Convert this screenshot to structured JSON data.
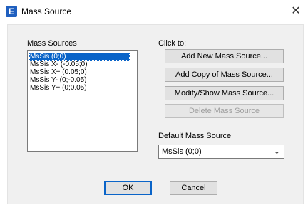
{
  "window": {
    "title": "Mass Source",
    "icon_glyph": "E",
    "close_glyph": "✕"
  },
  "left_panel": {
    "heading": "Mass Sources",
    "items": [
      "MsSis (0;0)",
      "MsSis X-  (-0.05;0)",
      "MsSis X+  (0.05;0)",
      "MsSis Y-  (0;-0.05)",
      "MsSis Y+  (0;0.05)"
    ],
    "selected_index": 0
  },
  "right_panel": {
    "heading": "Click to:",
    "add_new": "Add New Mass Source...",
    "add_copy": "Add Copy of Mass Source...",
    "modify_show": "Modify/Show Mass Source...",
    "delete": "Delete Mass Source",
    "default_heading": "Default Mass Source",
    "default_value": "MsSis (0;0)"
  },
  "footer": {
    "ok": "OK",
    "cancel": "Cancel"
  },
  "colors": {
    "selection": "#0a64c8",
    "app_icon": "#1f5fbf"
  },
  "icons": {
    "app": "app-e-icon",
    "close": "close-icon",
    "dropdown": "chevron-down-icon"
  }
}
